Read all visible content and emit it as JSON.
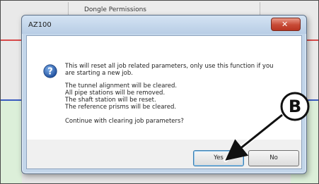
{
  "background": {
    "tab_label": "Dongle Permissions"
  },
  "dialog": {
    "title": "AZ100",
    "close_glyph": "✕",
    "icon": "question-mark-icon",
    "message_line1": "This will reset all job related parameters, only use this function if you",
    "message_line2": "are starting a new job.",
    "details": [
      "The tunnel alignment will be cleared.",
      "All pipe stations will be removed.",
      "The shaft station will be reset.",
      "The reference prisms will be cleared."
    ],
    "question": "Continue with clearing job parameters?",
    "yes_label": "Yes",
    "no_label": "No"
  },
  "callout": {
    "label": "B"
  },
  "colors": {
    "title_bar": "#c3d6ea",
    "close_button": "#c74a35",
    "accent_blue": "#2f63b6",
    "bg_red_line": "#d84a4a",
    "bg_blue_line": "#3a5bbf",
    "bg_green": "#dcefd9"
  }
}
